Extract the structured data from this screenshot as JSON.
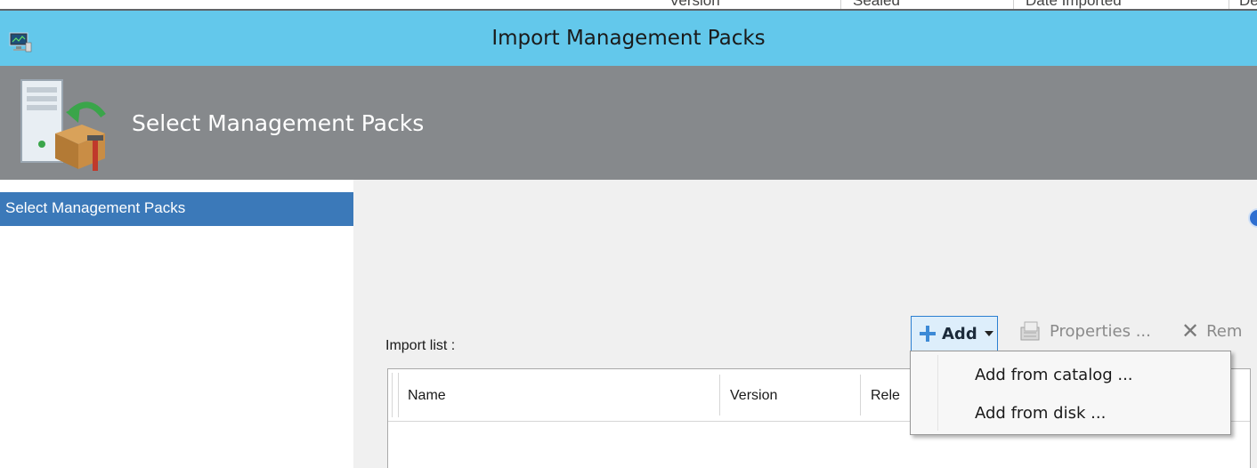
{
  "background_window": {
    "columns": [
      "Version",
      "Sealed",
      "Date Imported",
      "Description"
    ]
  },
  "titlebar": {
    "title": "Import Management Packs",
    "icon": "monitor-app-icon",
    "color": "#63c8eb"
  },
  "header": {
    "title": "Select Management Packs",
    "icon": "server-package-icon",
    "color": "#86898c"
  },
  "nav": {
    "items": [
      {
        "label": "Select Management Packs",
        "selected": true
      }
    ],
    "selected_color": "#3b79b9"
  },
  "main": {
    "import_list_label": "Import list :",
    "toolbar": {
      "add_label": "Add",
      "properties_label": "Properties ...",
      "remove_label": "Rem"
    },
    "list": {
      "columns": [
        "Name",
        "Version",
        "Rele"
      ]
    }
  },
  "add_menu": {
    "items": [
      "Add from catalog ...",
      "Add from disk ..."
    ]
  }
}
